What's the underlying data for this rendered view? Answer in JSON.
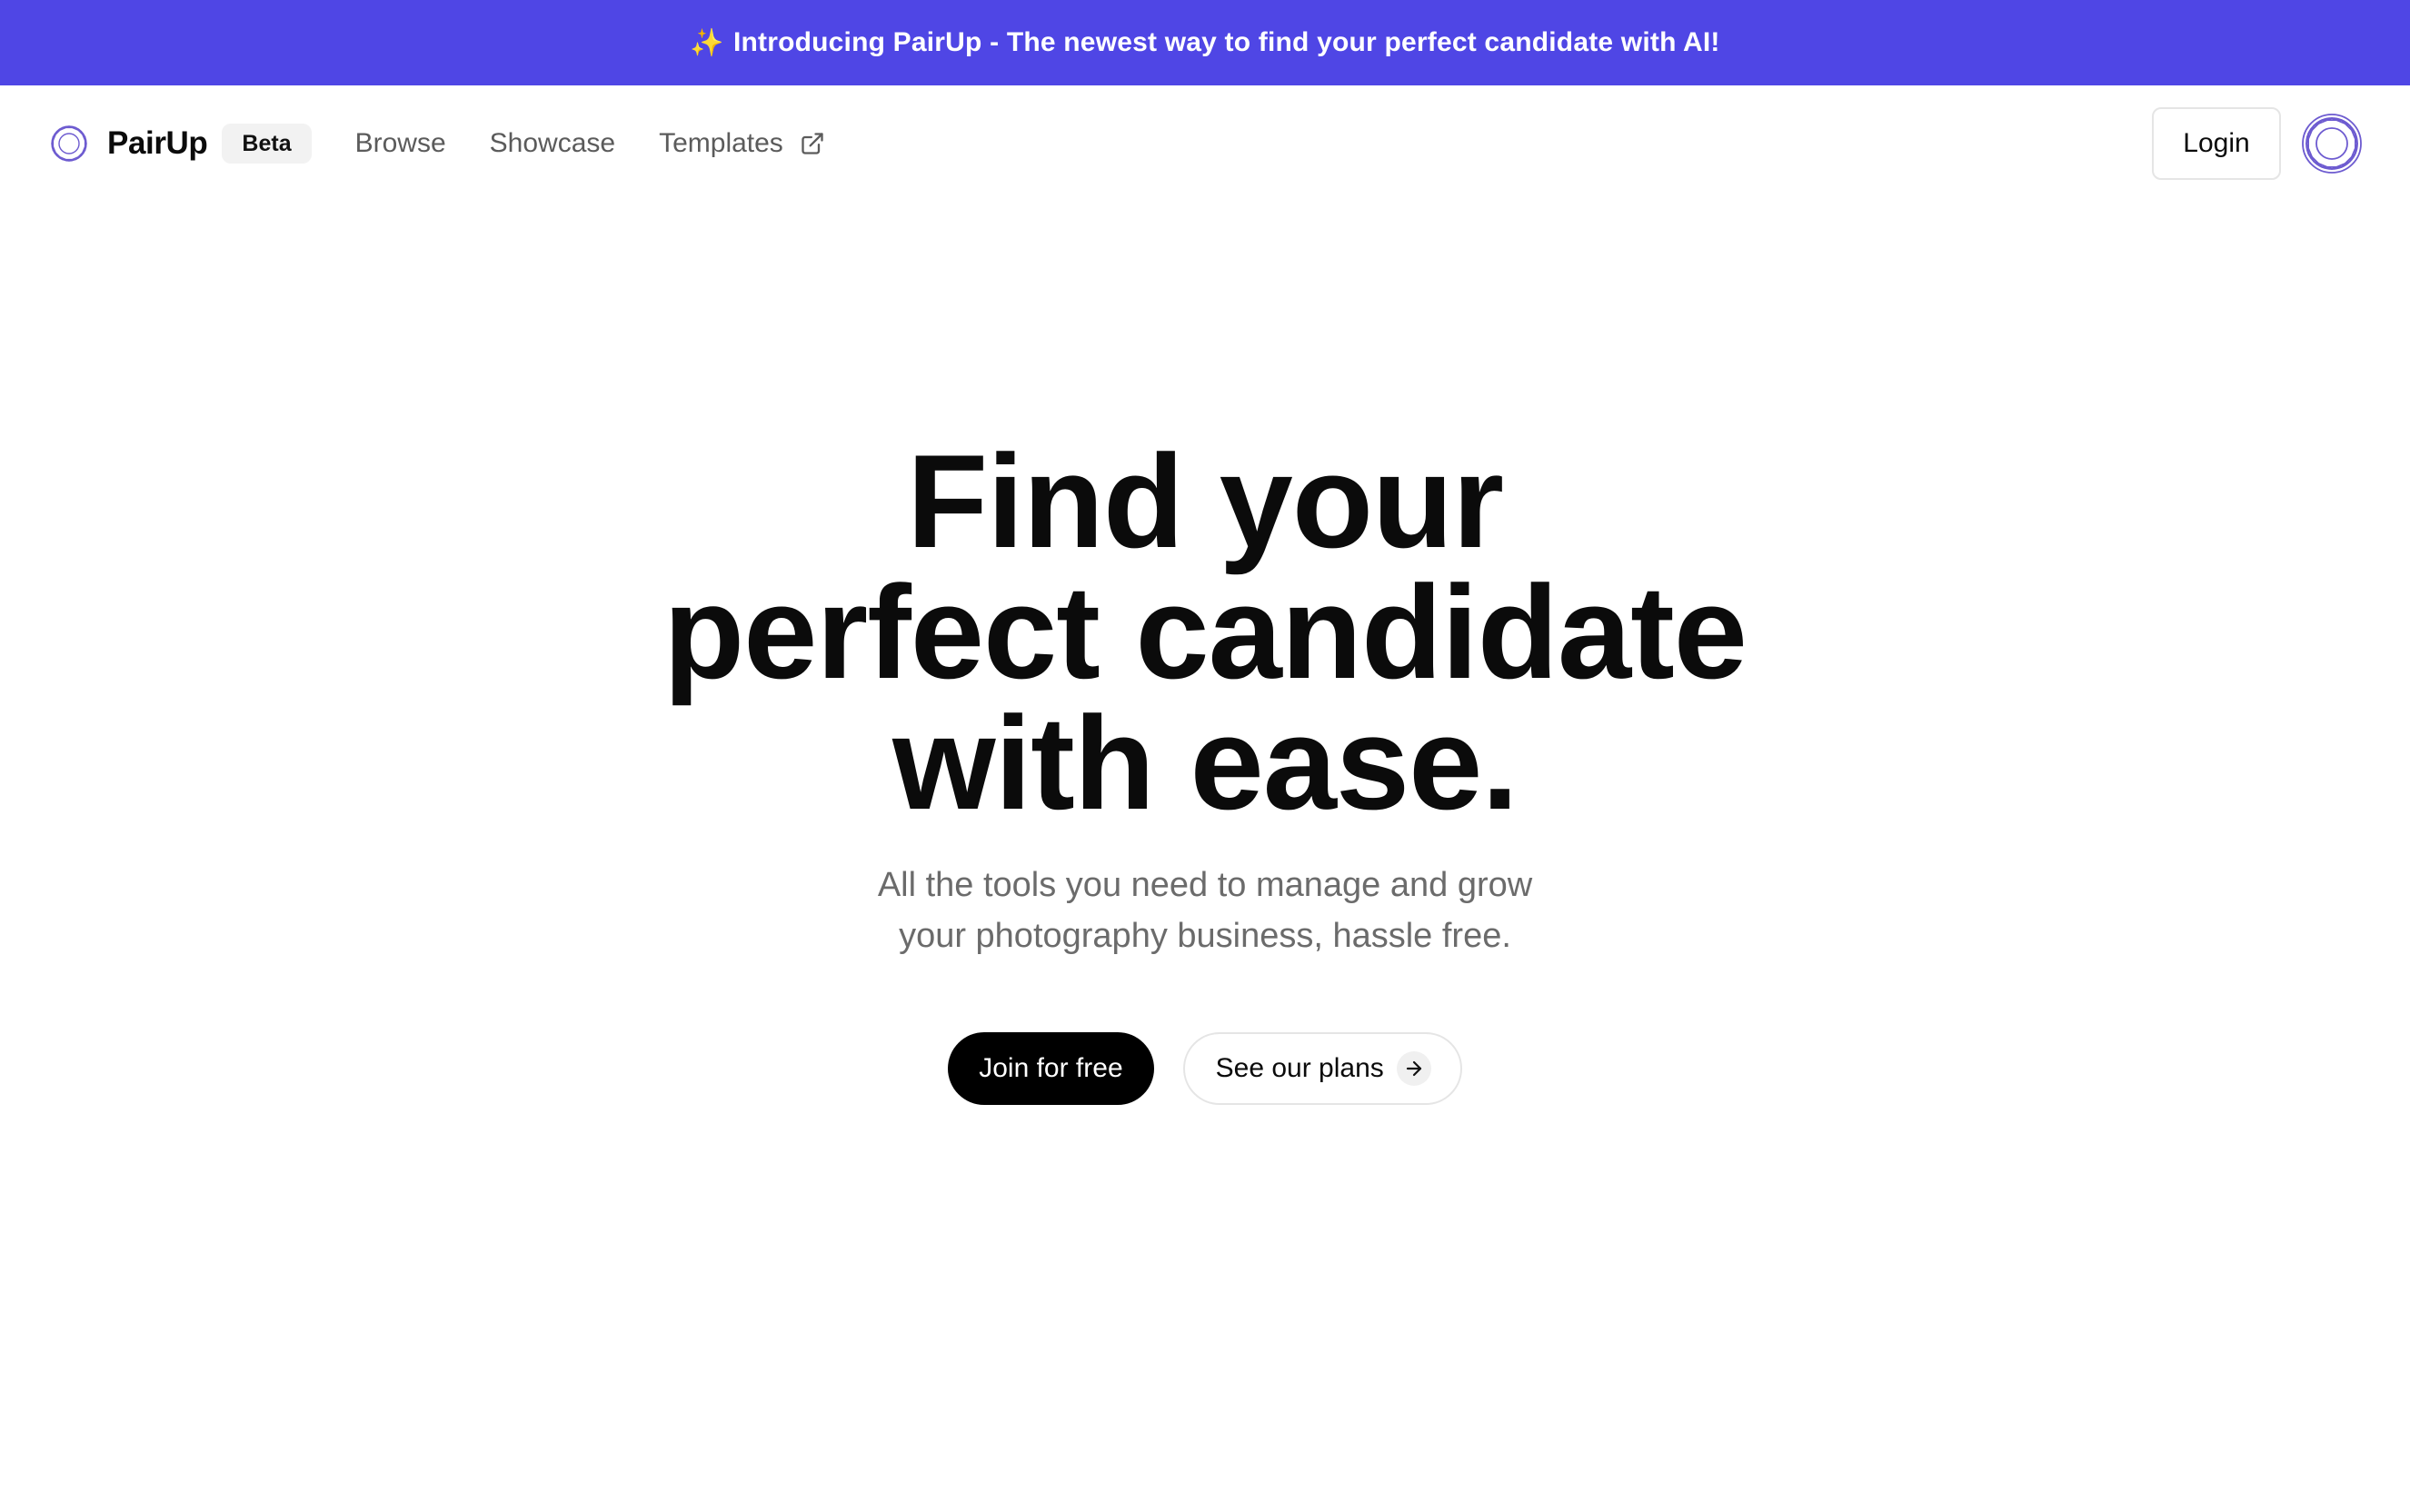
{
  "announcement": {
    "sparkle": "✨",
    "text": "Introducing PairUp - The newest way to find your perfect candidate with AI!"
  },
  "nav": {
    "brand": "PairUp",
    "badge": "Beta",
    "links": [
      "Browse",
      "Showcase",
      "Templates"
    ],
    "login_label": "Login",
    "icons": {
      "logo": "pairup-logo-icon",
      "external": "external-link-icon",
      "avatar": "avatar-icon"
    }
  },
  "hero": {
    "title_lines": [
      "Find your",
      "perfect candidate",
      "with ease."
    ],
    "subtitle": "All the tools you need to manage and grow your photography business, hassle free.",
    "primary_cta": "Join for free",
    "secondary_cta": "See our plans",
    "secondary_icon": "arrow-right-icon"
  },
  "colors": {
    "accent": "#4f46e5",
    "logo_stroke": "#6d5bd0",
    "text": "#0b0b0b",
    "muted": "#6b6b6b"
  }
}
